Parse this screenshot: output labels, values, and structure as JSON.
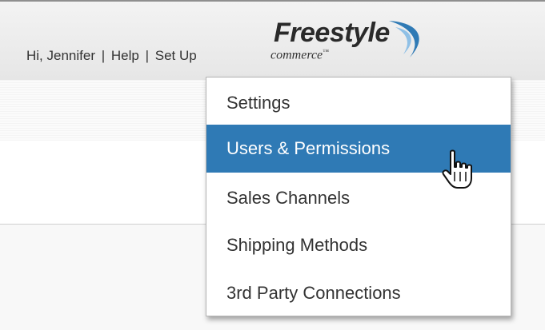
{
  "header": {
    "greeting": "Hi, Jennifer",
    "separator": "|",
    "help": "Help",
    "setup": "Set Up"
  },
  "logo": {
    "main": "Freestyle",
    "sub": "commerce",
    "tm": "™",
    "accent_color": "#2f7ab5"
  },
  "menu": {
    "items": [
      {
        "label": "Settings"
      },
      {
        "label": "Users & Permissions"
      },
      {
        "label": "Sales Channels"
      },
      {
        "label": "Shipping Methods"
      },
      {
        "label": "3rd Party Connections"
      }
    ],
    "active_index": 1,
    "active_color": "#2f7ab5"
  },
  "cursor": {
    "icon": "hand-pointer-icon"
  }
}
